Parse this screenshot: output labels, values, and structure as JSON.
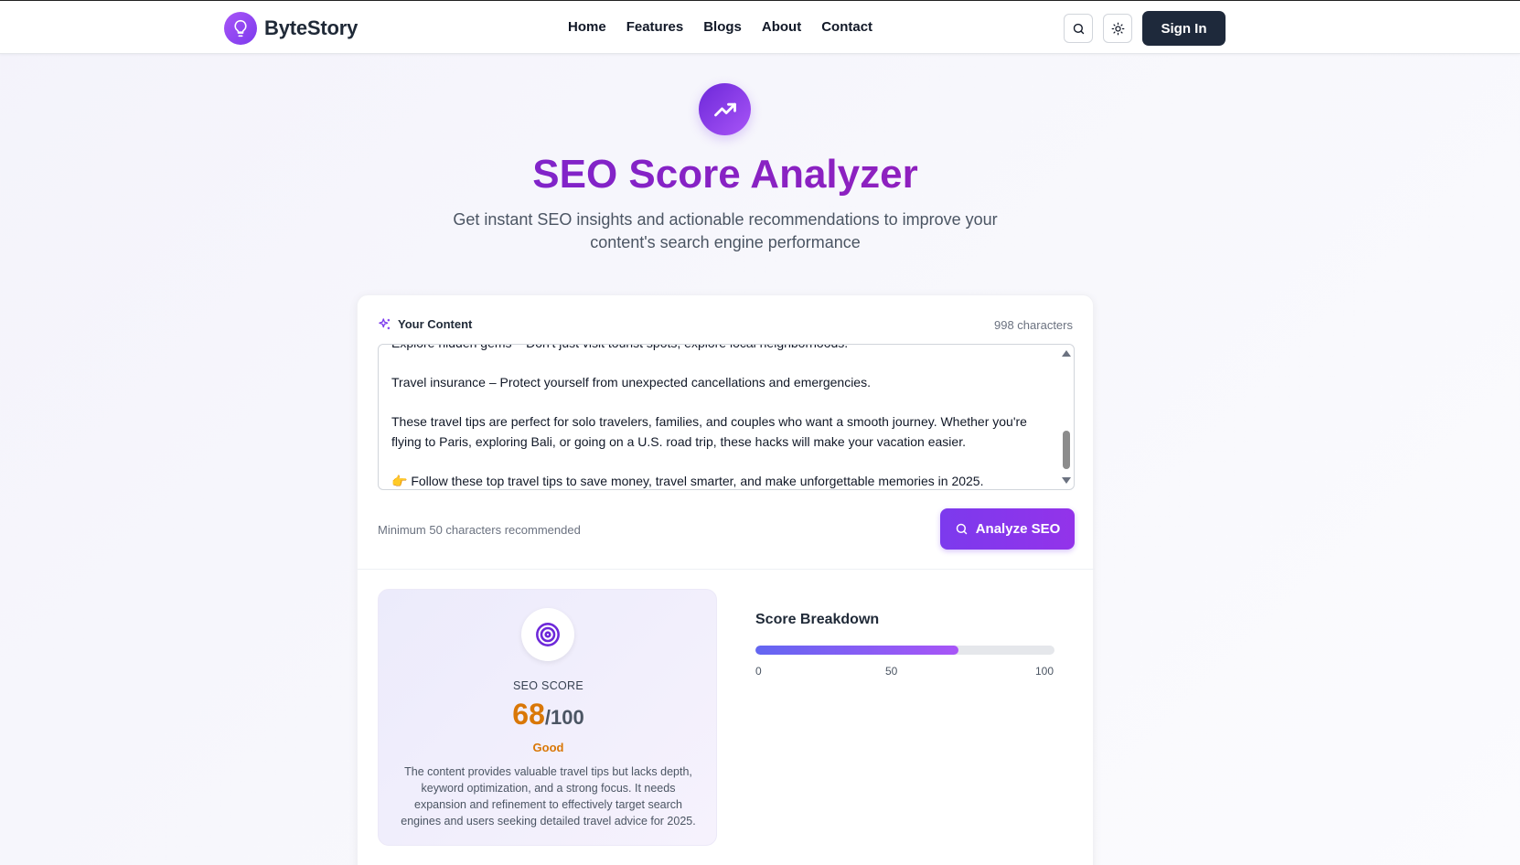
{
  "header": {
    "brand": "ByteStory",
    "nav": [
      "Home",
      "Features",
      "Blogs",
      "About",
      "Contact"
    ],
    "sign_in_label": "Sign In"
  },
  "hero": {
    "title": "SEO Score Analyzer",
    "subtitle": "Get instant SEO insights and actionable recommendations to improve your content's search engine performance"
  },
  "editor": {
    "label": "Your Content",
    "char_count": "998 characters",
    "text": "Explore hidden gems – Don't just visit tourist spots, explore local neighborhoods.\n\nTravel insurance – Protect yourself from unexpected cancellations and emergencies.\n\nThese travel tips are perfect for solo travelers, families, and couples who want a smooth journey. Whether you're flying to Paris, exploring Bali, or going on a U.S. road trip, these hacks will make your vacation easier.\n\n👉 Follow these top travel tips to save money, travel smarter, and make unforgettable memories in 2025.",
    "scroll_position": 0.55,
    "hint": "Minimum 50 characters recommended",
    "analyze_label": "Analyze SEO"
  },
  "result": {
    "label": "SEO SCORE",
    "score": "68",
    "max": "/100",
    "rating": "Good",
    "summary": "The content provides valuable travel tips but lacks depth, keyword optimization, and a strong focus. It needs expansion and refinement to effectively target search engines and users seeking detailed travel advice for 2025."
  },
  "breakdown": {
    "title": "Score Breakdown",
    "value": 68,
    "ticks": [
      "0",
      "50",
      "100"
    ]
  },
  "colors": {
    "accent": "#7c3aed",
    "score": "#d97706",
    "dark_button": "#1e293b"
  }
}
